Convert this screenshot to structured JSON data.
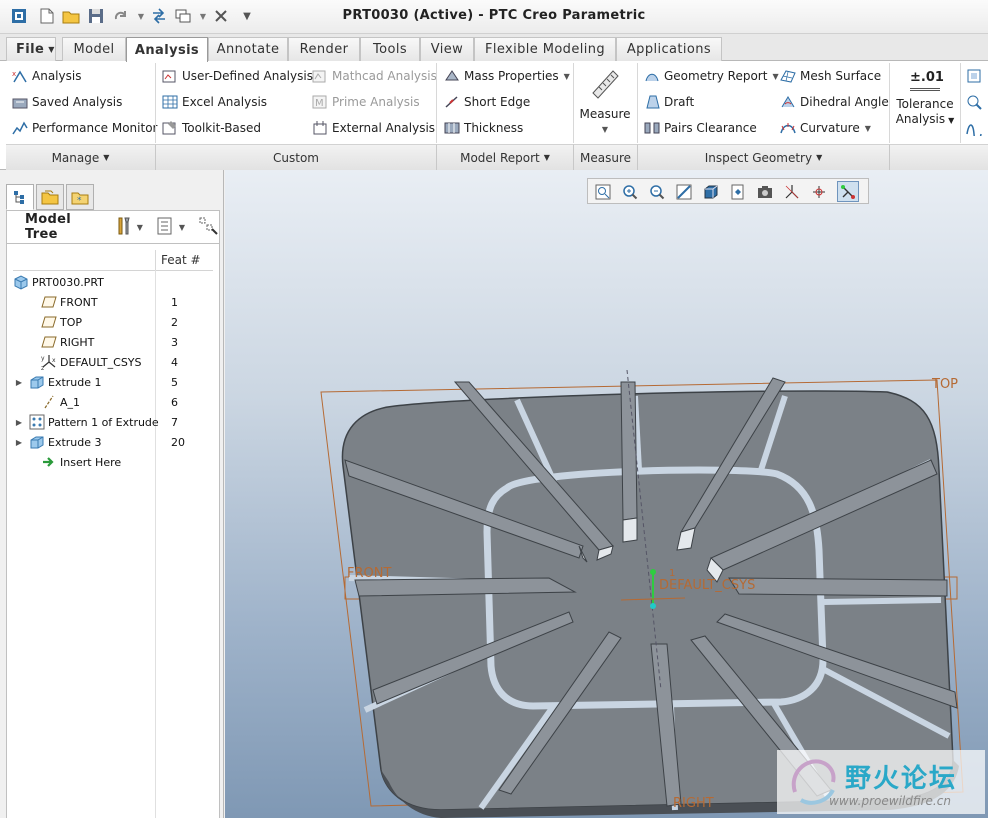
{
  "window": {
    "title": "PRT0030 (Active) - PTC Creo Parametric"
  },
  "tabs": [
    {
      "label": "File",
      "dropdown": true
    },
    {
      "label": "Model"
    },
    {
      "label": "Analysis",
      "active": true
    },
    {
      "label": "Annotate"
    },
    {
      "label": "Render"
    },
    {
      "label": "Tools"
    },
    {
      "label": "View"
    },
    {
      "label": "Flexible Modeling"
    },
    {
      "label": "Applications"
    }
  ],
  "ribbon": {
    "manage": {
      "items": [
        "Analysis",
        "Saved Analysis",
        "Performance Monitor"
      ],
      "group_label": "Manage"
    },
    "custom": {
      "items": [
        "User-Defined Analysis",
        "Excel Analysis",
        "Toolkit-Based",
        "Mathcad Analysis",
        "Prime Analysis",
        "External Analysis"
      ],
      "group_label": "Custom"
    },
    "model_report": {
      "items": [
        "Mass Properties",
        "Short Edge",
        "Thickness"
      ],
      "group_label": "Model Report"
    },
    "measure": {
      "big_label": "Measure",
      "group_label": "Measure"
    },
    "inspect_geometry": {
      "items": [
        "Geometry Report",
        "Draft",
        "Pairs Clearance",
        "Mesh Surface",
        "Dihedral Angle",
        "Curvature"
      ],
      "group_label": "Inspect Geometry"
    },
    "tolerance": {
      "icon_text": "±.01",
      "line1": "Tolerance",
      "line2": "Analysis"
    }
  },
  "model_tree": {
    "title": "Model Tree",
    "column_header": "Feat #",
    "root": "PRT0030.PRT",
    "items": [
      {
        "label": "FRONT",
        "num": "1",
        "icon": "datum-plane-icon"
      },
      {
        "label": "TOP",
        "num": "2",
        "icon": "datum-plane-icon"
      },
      {
        "label": "RIGHT",
        "num": "3",
        "icon": "datum-plane-icon"
      },
      {
        "label": "DEFAULT_CSYS",
        "num": "4",
        "icon": "coordinate-system-icon"
      },
      {
        "label": "Extrude 1",
        "num": "5",
        "icon": "extrude-icon",
        "expandable": true
      },
      {
        "label": "A_1",
        "num": "6",
        "icon": "datum-axis-icon"
      },
      {
        "label": "Pattern 1 of Extrude",
        "num": "7",
        "icon": "pattern-icon",
        "expandable": true
      },
      {
        "label": "Extrude 3",
        "num": "20",
        "icon": "extrude-icon",
        "expandable": true
      },
      {
        "label": "Insert Here",
        "num": "",
        "icon": "insert-arrow-icon"
      }
    ]
  },
  "viewport": {
    "datum_labels": {
      "top": "TOP",
      "front": "FRONT",
      "right": "RIGHT",
      "csys": "DEFAULT_CSYS",
      "axis": "1"
    },
    "watermark": {
      "text": "野火论坛",
      "url": "www.proewildfire.cn"
    }
  },
  "colors": {
    "model_fill": "#7b8187",
    "model_dark": "#4a4f55",
    "datum": "#b56a34",
    "viewport_top": "#e9eef4",
    "viewport_bottom": "#7f98b4"
  }
}
